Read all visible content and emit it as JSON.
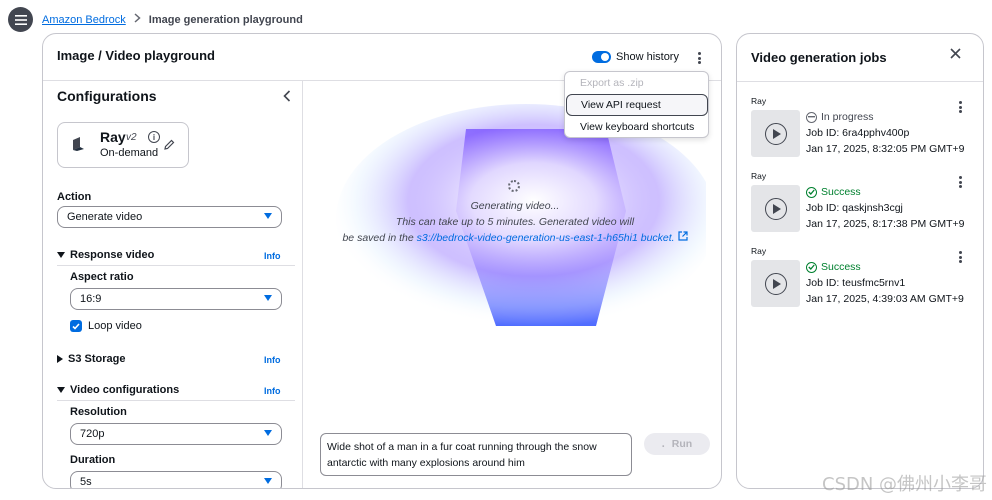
{
  "nav": {
    "breadcrumb_root": "Amazon Bedrock",
    "breadcrumb_current": "Image generation playground"
  },
  "playground": {
    "title": "Image / Video playground",
    "show_history_label": "Show history",
    "show_history_on": true,
    "menu": {
      "items": [
        {
          "label": "Export as .zip",
          "disabled": true
        },
        {
          "label": "View API request",
          "disabled": false
        },
        {
          "label": "View keyboard shortcuts",
          "disabled": false
        }
      ]
    }
  },
  "config": {
    "title": "Configurations",
    "model": {
      "name": "Ray",
      "version": "v2",
      "info_icon": "i",
      "mode": "On-demand"
    },
    "action": {
      "label": "Action",
      "value": "Generate video"
    },
    "response_video": {
      "label": "Response video",
      "info": "Info",
      "aspect_ratio_label": "Aspect ratio",
      "aspect_ratio_value": "16:9",
      "loop_label": "Loop video",
      "loop_checked": true
    },
    "s3_storage": {
      "label": "S3 Storage",
      "info": "Info"
    },
    "video_config": {
      "label": "Video configurations",
      "info": "Info",
      "resolution_label": "Resolution",
      "resolution_value": "720p",
      "duration_label": "Duration",
      "duration_value": "5s"
    }
  },
  "canvas": {
    "generating_line1": "Generating video...",
    "generating_line2": "This can take up to 5 minutes. Generated video will",
    "generating_line3_prefix": "be saved in the",
    "s3_link": "s3://bedrock-video-generation-us-east-1-h65hi1 bucket.",
    "prompt_text": "Wide shot of a man in a fur coat running through the snow antarctic with many explosions around him",
    "run_label": "Run"
  },
  "jobs": {
    "title": "Video generation jobs",
    "items": [
      {
        "model": "Ray",
        "status": "In progress",
        "status_type": "progress",
        "job_id": "Job ID: 6ra4pphv400p",
        "date": "Jan 17, 2025, 8:32:05 PM GMT+9"
      },
      {
        "model": "Ray",
        "status": "Success",
        "status_type": "success",
        "job_id": "Job ID: qaskjnsh3cgj",
        "date": "Jan 17, 2025, 8:17:38 PM GMT+9"
      },
      {
        "model": "Ray",
        "status": "Success",
        "status_type": "success",
        "job_id": "Job ID: teusfmc5rnv1",
        "date": "Jan 17, 2025, 4:39:03 AM GMT+9"
      }
    ]
  },
  "watermark": "CSDN @佛州小李哥",
  "colors": {
    "accent": "#006ce0",
    "success": "#00802f",
    "border": "#c6c6cd"
  }
}
